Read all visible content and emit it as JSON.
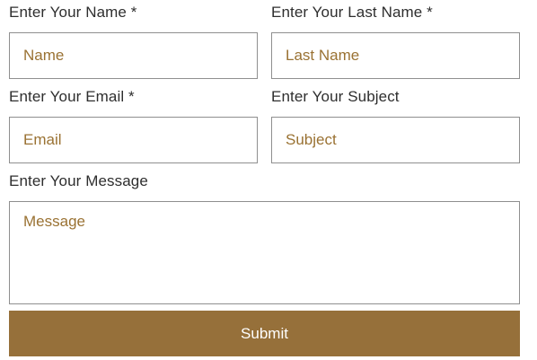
{
  "form": {
    "first_name": {
      "label": "Enter Your Name *",
      "value": "",
      "placeholder": "Name"
    },
    "last_name": {
      "label": "Enter Your Last Name *",
      "value": "",
      "placeholder": "Last Name"
    },
    "email": {
      "label": "Enter Your Email *",
      "value": "",
      "placeholder": "Email"
    },
    "subject": {
      "label": "Enter Your Subject",
      "value": "",
      "placeholder": "Subject"
    },
    "message": {
      "label": "Enter Your Message",
      "value": "",
      "placeholder": "Message"
    },
    "submit_label": "Submit"
  },
  "colors": {
    "accent": "#96703a",
    "placeholder": "#9a7233",
    "border": "#8f8f8f",
    "label_text": "#2e2e2e"
  }
}
